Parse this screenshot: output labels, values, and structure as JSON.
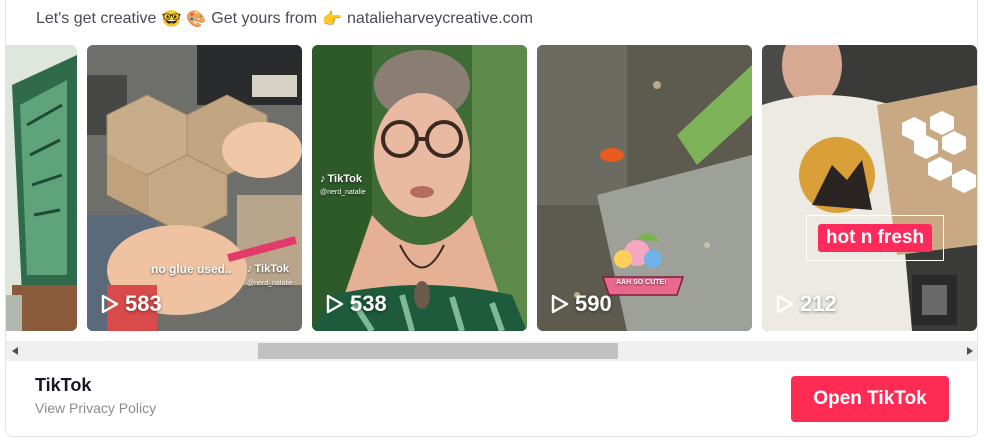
{
  "bio": {
    "text_start": "Let's get creative",
    "emoji_1": "🤓",
    "emoji_2": "🎨",
    "text_middle": "Get yours from",
    "emoji_pointing": "👉",
    "website": "natalieharveycreative.com"
  },
  "videos": [
    {
      "views": "",
      "overlay_text": "",
      "thumbnail": "green-leaf-artwork"
    },
    {
      "views": "583",
      "overlay_text": "no glue used..",
      "watermark": "TikTok",
      "handle": "@nerd_natalie",
      "thumbnail": "cardboard-hexagon"
    },
    {
      "views": "538",
      "overlay_text": "",
      "watermark": "TikTok",
      "handle": "@nerd_natalie",
      "thumbnail": "woman-selfie"
    },
    {
      "views": "590",
      "overlay_text": "",
      "sticker_text": "AAH SO CUTE!",
      "thumbnail": "forest-floor-frog"
    },
    {
      "views": "212",
      "overlay_text": "hot n fresh",
      "thumbnail": "woman-hexagon-board"
    }
  ],
  "footer": {
    "brand": "TikTok",
    "privacy_link": "View Privacy Policy",
    "open_button": "Open TikTok"
  },
  "colors": {
    "accent": "#fe2c55",
    "muted_text": "#8a8b91"
  }
}
